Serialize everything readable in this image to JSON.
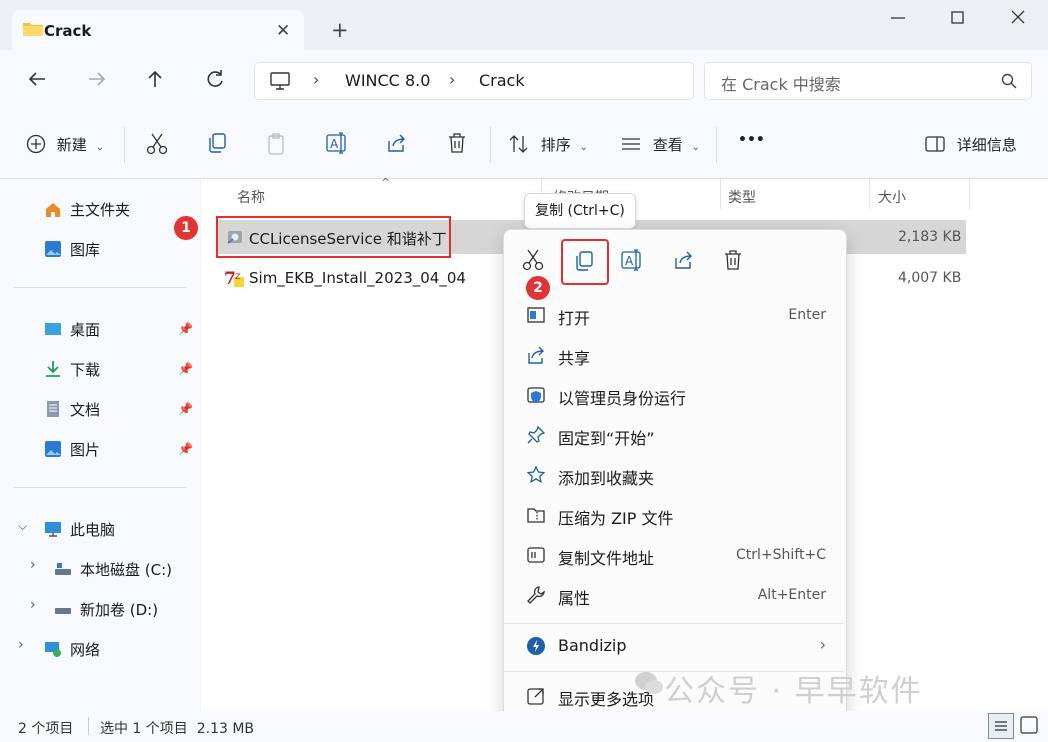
{
  "window": {
    "tab_title": "Crack",
    "add_tab": "+",
    "close_tab": "✕"
  },
  "nav": {
    "breadcrumb": [
      "WINCC 8.0",
      "Crack"
    ],
    "search_placeholder": "在 Crack 中搜索"
  },
  "toolbar": {
    "new_label": "新建",
    "sort_label": "排序",
    "view_label": "查看",
    "more_label": "•••",
    "details_label": "详细信息"
  },
  "sidebar": {
    "home": "主文件夹",
    "gallery": "图库",
    "desktop": "桌面",
    "downloads": "下载",
    "documents": "文档",
    "pictures": "图片",
    "this_pc": "此电脑",
    "drive_c": "本地磁盘 (C:)",
    "drive_d": "新加卷 (D:)",
    "network": "网络"
  },
  "columns": {
    "name": "名称",
    "date": "修改日期",
    "type": "类型",
    "size": "大小"
  },
  "files": [
    {
      "name": "CCLicenseService 和谐补丁",
      "size": "2,183 KB",
      "selected": true
    },
    {
      "name": "Sim_EKB_Install_2023_04_04",
      "size": "4,007 KB",
      "selected": false
    }
  ],
  "markers": {
    "one": "1",
    "two": "2"
  },
  "tooltip": "复制 (Ctrl+C)",
  "context_menu": {
    "items": [
      {
        "label": "打开",
        "shortcut": "Enter",
        "icon": "open-icon"
      },
      {
        "label": "共享",
        "shortcut": "",
        "icon": "share-icon"
      },
      {
        "label": "以管理员身份运行",
        "shortcut": "",
        "icon": "shield-icon"
      },
      {
        "label": "固定到“开始”",
        "shortcut": "",
        "icon": "pin-icon"
      },
      {
        "label": "添加到收藏夹",
        "shortcut": "",
        "icon": "star-icon"
      },
      {
        "label": "压缩为 ZIP 文件",
        "shortcut": "",
        "icon": "zip-icon"
      },
      {
        "label": "复制文件地址",
        "shortcut": "Ctrl+Shift+C",
        "icon": "path-icon"
      },
      {
        "label": "属性",
        "shortcut": "Alt+Enter",
        "icon": "wrench-icon"
      },
      {
        "label": "Bandizip",
        "shortcut": "›",
        "icon": "bandizip-icon"
      },
      {
        "label": "显示更多选项",
        "shortcut": "",
        "icon": "more-options-icon"
      }
    ]
  },
  "status": {
    "count": "2 个项目",
    "selection": "选中 1 个项目  2.13 MB"
  },
  "watermark": "公众号 · 早早软件",
  "colors": {
    "marker": "#e23434",
    "selection": "#d6d6d6",
    "accent": "#0067c0"
  }
}
